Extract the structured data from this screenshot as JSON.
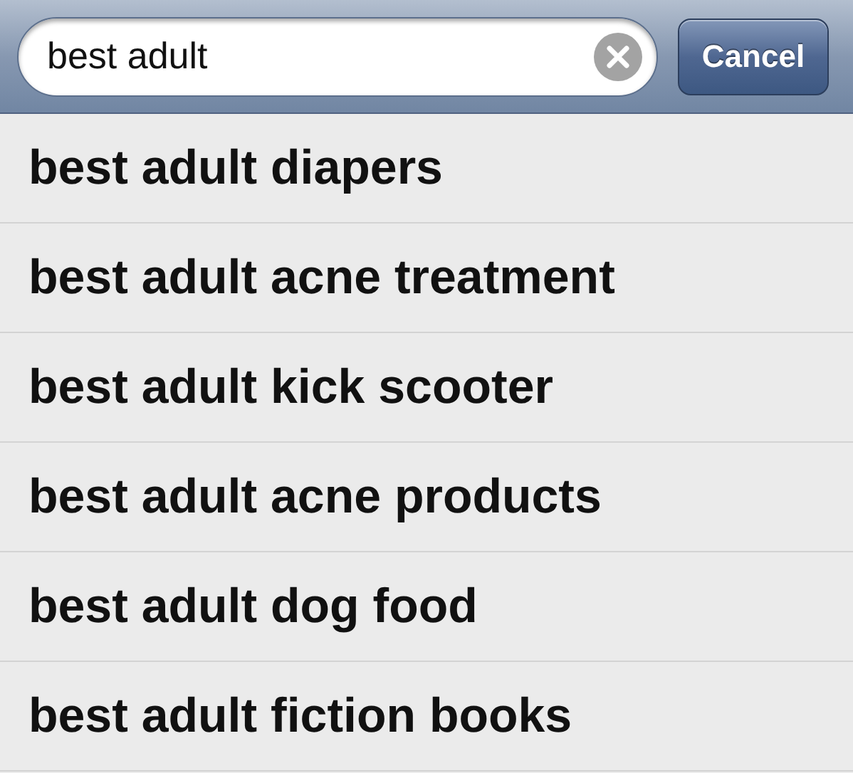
{
  "search": {
    "value": "best adult",
    "clear_button": true
  },
  "cancel_button": "Cancel",
  "suggestions": [
    "best adult diapers",
    "best adult acne treatment",
    "best adult kick scooter",
    "best adult acne products",
    "best adult dog food",
    "best adult fiction books"
  ]
}
